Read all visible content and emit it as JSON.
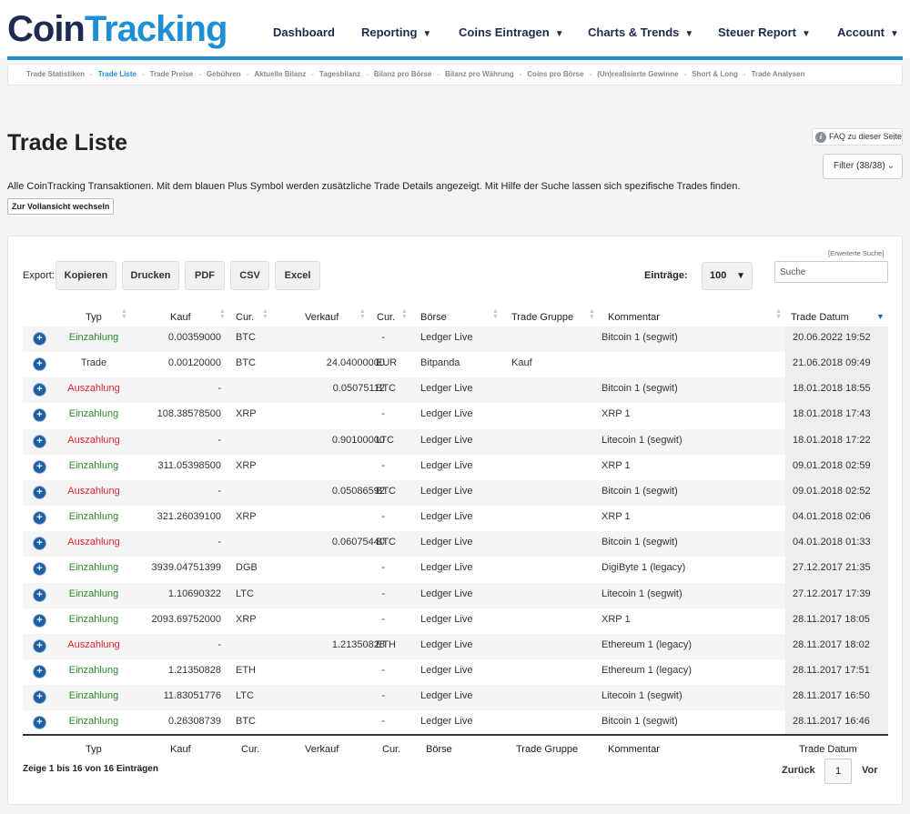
{
  "logo": {
    "part1": "Coin",
    "part2": "Tracking"
  },
  "nav": [
    {
      "label": "Dashboard",
      "caret": ""
    },
    {
      "label": "Reporting",
      "caret": "▼"
    },
    {
      "label": "Coins Eintragen",
      "caret": "▼"
    },
    {
      "label": "Charts & Trends",
      "caret": "▼"
    },
    {
      "label": "Steuer Report",
      "caret": "▼"
    },
    {
      "label": "Account",
      "caret": "▼"
    }
  ],
  "subnav": [
    "Trade Statistiken",
    "Trade Liste",
    "Trade Preise",
    "Gebühren",
    "Aktuelle Bilanz",
    "Tagesbilanz",
    "Bilanz pro Börse",
    "Bilanz pro Währung",
    "Coins pro Börse",
    "(Un)realisierte Gewinne",
    "Short & Long",
    "Trade Analysen"
  ],
  "subnav_separator": "-",
  "page": {
    "title": "Trade Liste",
    "faq_label": "FAQ zu dieser Seite",
    "filter_label": "Filter (38/38)",
    "description": "Alle CoinTracking Transaktionen. Mit dem blauen Plus Symbol werden zusätzliche Trade Details angezeigt. Mit Hilfe der Suche lassen sich spezifische Trades finden.",
    "fullview_label": "Zur Vollansicht wechseln"
  },
  "toolbar": {
    "advanced_search": "[Erweiterte Suche]",
    "export_label": "Export:",
    "buttons": [
      "Kopieren",
      "Drucken",
      "PDF",
      "CSV",
      "Excel"
    ],
    "entries_label": "Einträge:",
    "entries_value": "100",
    "search_placeholder": "Suche"
  },
  "table": {
    "headers": [
      "Typ",
      "Kauf",
      "Cur.",
      "Verkauf",
      "Cur.",
      "Börse",
      "Trade Gruppe",
      "Kommentar",
      "Trade Datum"
    ],
    "rows": [
      {
        "typ": "Einzahlung",
        "kind": "in",
        "kauf": "0.00359000",
        "cur1": "BTC",
        "verkauf": "-",
        "cur2": "",
        "boerse": "Ledger Live",
        "gruppe": "",
        "kommentar": "Bitcoin 1 (segwit)",
        "datum": "20.06.2022 19:52"
      },
      {
        "typ": "Trade",
        "kind": "tr",
        "kauf": "0.00120000",
        "cur1": "BTC",
        "verkauf": "24.04000000",
        "cur2": "EUR",
        "boerse": "Bitpanda",
        "gruppe": "Kauf",
        "kommentar": "",
        "datum": "21.06.2018 09:49"
      },
      {
        "typ": "Auszahlung",
        "kind": "out",
        "kauf": "-",
        "cur1": "",
        "verkauf": "0.05075112",
        "cur2": "BTC",
        "boerse": "Ledger Live",
        "gruppe": "",
        "kommentar": "Bitcoin 1 (segwit)",
        "datum": "18.01.2018 18:55"
      },
      {
        "typ": "Einzahlung",
        "kind": "in",
        "kauf": "108.38578500",
        "cur1": "XRP",
        "verkauf": "-",
        "cur2": "",
        "boerse": "Ledger Live",
        "gruppe": "",
        "kommentar": "XRP 1",
        "datum": "18.01.2018 17:43"
      },
      {
        "typ": "Auszahlung",
        "kind": "out",
        "kauf": "-",
        "cur1": "",
        "verkauf": "0.90100000",
        "cur2": "LTC",
        "boerse": "Ledger Live",
        "gruppe": "",
        "kommentar": "Litecoin 1 (segwit)",
        "datum": "18.01.2018 17:22"
      },
      {
        "typ": "Einzahlung",
        "kind": "in",
        "kauf": "311.05398500",
        "cur1": "XRP",
        "verkauf": "-",
        "cur2": "",
        "boerse": "Ledger Live",
        "gruppe": "",
        "kommentar": "XRP 1",
        "datum": "09.01.2018 02:59"
      },
      {
        "typ": "Auszahlung",
        "kind": "out",
        "kauf": "-",
        "cur1": "",
        "verkauf": "0.05086592",
        "cur2": "BTC",
        "boerse": "Ledger Live",
        "gruppe": "",
        "kommentar": "Bitcoin 1 (segwit)",
        "datum": "09.01.2018 02:52"
      },
      {
        "typ": "Einzahlung",
        "kind": "in",
        "kauf": "321.26039100",
        "cur1": "XRP",
        "verkauf": "-",
        "cur2": "",
        "boerse": "Ledger Live",
        "gruppe": "",
        "kommentar": "XRP 1",
        "datum": "04.01.2018 02:06"
      },
      {
        "typ": "Auszahlung",
        "kind": "out",
        "kauf": "-",
        "cur1": "",
        "verkauf": "0.06075440",
        "cur2": "BTC",
        "boerse": "Ledger Live",
        "gruppe": "",
        "kommentar": "Bitcoin 1 (segwit)",
        "datum": "04.01.2018 01:33"
      },
      {
        "typ": "Einzahlung",
        "kind": "in",
        "kauf": "3939.04751399",
        "cur1": "DGB",
        "verkauf": "-",
        "cur2": "",
        "boerse": "Ledger Live",
        "gruppe": "",
        "kommentar": "DigiByte 1 (legacy)",
        "datum": "27.12.2017 21:35"
      },
      {
        "typ": "Einzahlung",
        "kind": "in",
        "kauf": "1.10690322",
        "cur1": "LTC",
        "verkauf": "-",
        "cur2": "",
        "boerse": "Ledger Live",
        "gruppe": "",
        "kommentar": "Litecoin 1 (segwit)",
        "datum": "27.12.2017 17:39"
      },
      {
        "typ": "Einzahlung",
        "kind": "in",
        "kauf": "2093.69752000",
        "cur1": "XRP",
        "verkauf": "-",
        "cur2": "",
        "boerse": "Ledger Live",
        "gruppe": "",
        "kommentar": "XRP 1",
        "datum": "28.11.2017 18:05"
      },
      {
        "typ": "Auszahlung",
        "kind": "out",
        "kauf": "-",
        "cur1": "",
        "verkauf": "1.21350828",
        "cur2": "ETH",
        "boerse": "Ledger Live",
        "gruppe": "",
        "kommentar": "Ethereum 1 (legacy)",
        "datum": "28.11.2017 18:02"
      },
      {
        "typ": "Einzahlung",
        "kind": "in",
        "kauf": "1.21350828",
        "cur1": "ETH",
        "verkauf": "-",
        "cur2": "",
        "boerse": "Ledger Live",
        "gruppe": "",
        "kommentar": "Ethereum 1 (legacy)",
        "datum": "28.11.2017 17:51"
      },
      {
        "typ": "Einzahlung",
        "kind": "in",
        "kauf": "11.83051776",
        "cur1": "LTC",
        "verkauf": "-",
        "cur2": "",
        "boerse": "Ledger Live",
        "gruppe": "",
        "kommentar": "Litecoin 1 (segwit)",
        "datum": "28.11.2017 16:50"
      },
      {
        "typ": "Einzahlung",
        "kind": "in",
        "kauf": "0.26308739",
        "cur1": "BTC",
        "verkauf": "-",
        "cur2": "",
        "boerse": "Ledger Live",
        "gruppe": "",
        "kommentar": "Bitcoin 1 (segwit)",
        "datum": "28.11.2017 16:46"
      }
    ]
  },
  "footer": {
    "info": "Zeige 1 bis 16 von 16 Einträgen",
    "prev": "Zurück",
    "current_page": "1",
    "next": "Vor"
  },
  "colors": {
    "brand_dark": "#1d2b4f",
    "brand_blue": "#1e8fd5",
    "deposit": "#2a8a2a",
    "withdrawal": "#e0262a"
  }
}
